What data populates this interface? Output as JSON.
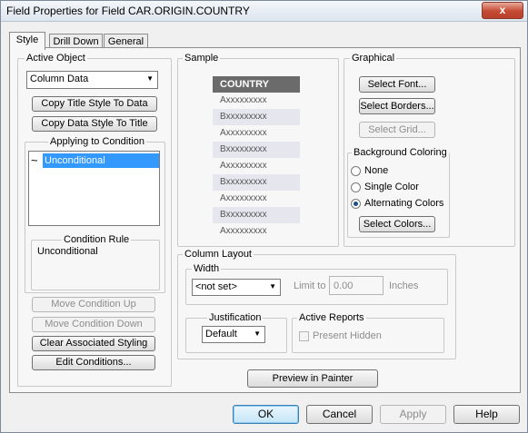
{
  "window": {
    "title": "Field Properties for Field CAR.ORIGIN.COUNTRY",
    "close_label": "x"
  },
  "tabs": [
    {
      "label": "Style"
    },
    {
      "label": "Drill Down"
    },
    {
      "label": "General"
    }
  ],
  "active_object": {
    "label": "Active Object",
    "select_value": "Column Data",
    "copy_title_btn": "Copy Title Style To Data",
    "copy_data_btn": "Copy Data Style To Title",
    "applying_label": "Applying to Condition",
    "condition_item": "Unconditional",
    "condition_rule_label": "Condition Rule",
    "condition_rule_value": "Unconditional",
    "move_up_btn": "Move Condition Up",
    "move_down_btn": "Move Condition Down",
    "clear_btn": "Clear Associated Styling",
    "edit_btn": "Edit Conditions..."
  },
  "sample": {
    "label": "Sample",
    "header": "COUNTRY",
    "rows": [
      "Axxxxxxxxx",
      "Bxxxxxxxxx",
      "Axxxxxxxxx",
      "Bxxxxxxxxx",
      "Axxxxxxxxx",
      "Bxxxxxxxxx",
      "Axxxxxxxxx",
      "Bxxxxxxxxx",
      "Axxxxxxxxx"
    ],
    "alt_color": "#e6e6ee",
    "header_color": "#6b6b6b"
  },
  "graphical": {
    "label": "Graphical",
    "select_font_btn": "Select Font...",
    "select_borders_btn": "Select Borders...",
    "select_grid_btn": "Select Grid...",
    "bg_label": "Background Coloring",
    "options": [
      "None",
      "Single Color",
      "Alternating Colors"
    ],
    "selected": "Alternating Colors",
    "select_colors_btn": "Select Colors..."
  },
  "column_layout": {
    "label": "Column Layout",
    "width_label": "Width",
    "width_value": "<not set>",
    "limit_label": "Limit to",
    "limit_value": "0.00",
    "units": "Inches",
    "justification_label": "Justification",
    "justification_value": "Default",
    "active_reports_label": "Active Reports",
    "present_hidden_label": "Present Hidden"
  },
  "preview_btn": "Preview in Painter",
  "footer": {
    "ok": "OK",
    "cancel": "Cancel",
    "apply": "Apply",
    "help": "Help"
  }
}
